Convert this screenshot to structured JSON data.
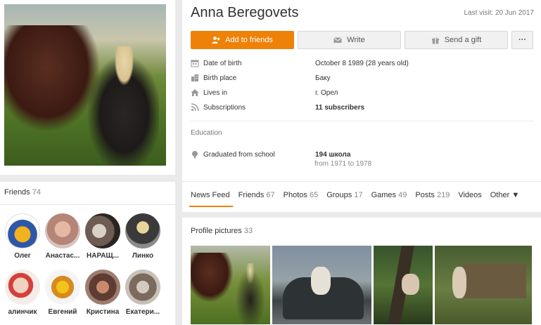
{
  "friends": {
    "title": "Friends",
    "count": "74",
    "list": [
      {
        "name": "Олег"
      },
      {
        "name": "Анастас..."
      },
      {
        "name": "НАРАЩ..."
      },
      {
        "name": "Линко"
      },
      {
        "name": "алинчик"
      },
      {
        "name": "Евгений"
      },
      {
        "name": "Кристина"
      },
      {
        "name": "Екатери..."
      }
    ]
  },
  "profile": {
    "name": "Anna Beregovets",
    "last_visit": "Last visit: 20 Jun 2017",
    "buttons": {
      "add_friends": "Add to friends",
      "write": "Write",
      "send_gift": "Send a gift",
      "more": "···"
    },
    "info": [
      {
        "icon": "calendar-icon",
        "label": "Date of birth",
        "value": "October 8 1989 (28 years old)"
      },
      {
        "icon": "building-icon",
        "label": "Birth place",
        "value": "Баку"
      },
      {
        "icon": "home-icon",
        "label": "Lives in",
        "value": "г. Орел"
      },
      {
        "icon": "rss-icon",
        "label": "Subscriptions",
        "value": "11 subscribers"
      }
    ],
    "education": {
      "title": "Education",
      "label": "Graduated from school",
      "school": "194 школа",
      "years": "from 1971 to 1978"
    }
  },
  "tabs": [
    {
      "label": "News Feed",
      "count": ""
    },
    {
      "label": "Friends",
      "count": "67"
    },
    {
      "label": "Photos",
      "count": "65"
    },
    {
      "label": "Groups",
      "count": "17"
    },
    {
      "label": "Games",
      "count": "49"
    },
    {
      "label": "Posts",
      "count": "219"
    },
    {
      "label": "Videos",
      "count": ""
    },
    {
      "label": "Other ▼",
      "count": ""
    }
  ],
  "profile_pictures": {
    "title": "Profile pictures",
    "count": "33"
  },
  "colors": {
    "accent": "#ee8208"
  }
}
